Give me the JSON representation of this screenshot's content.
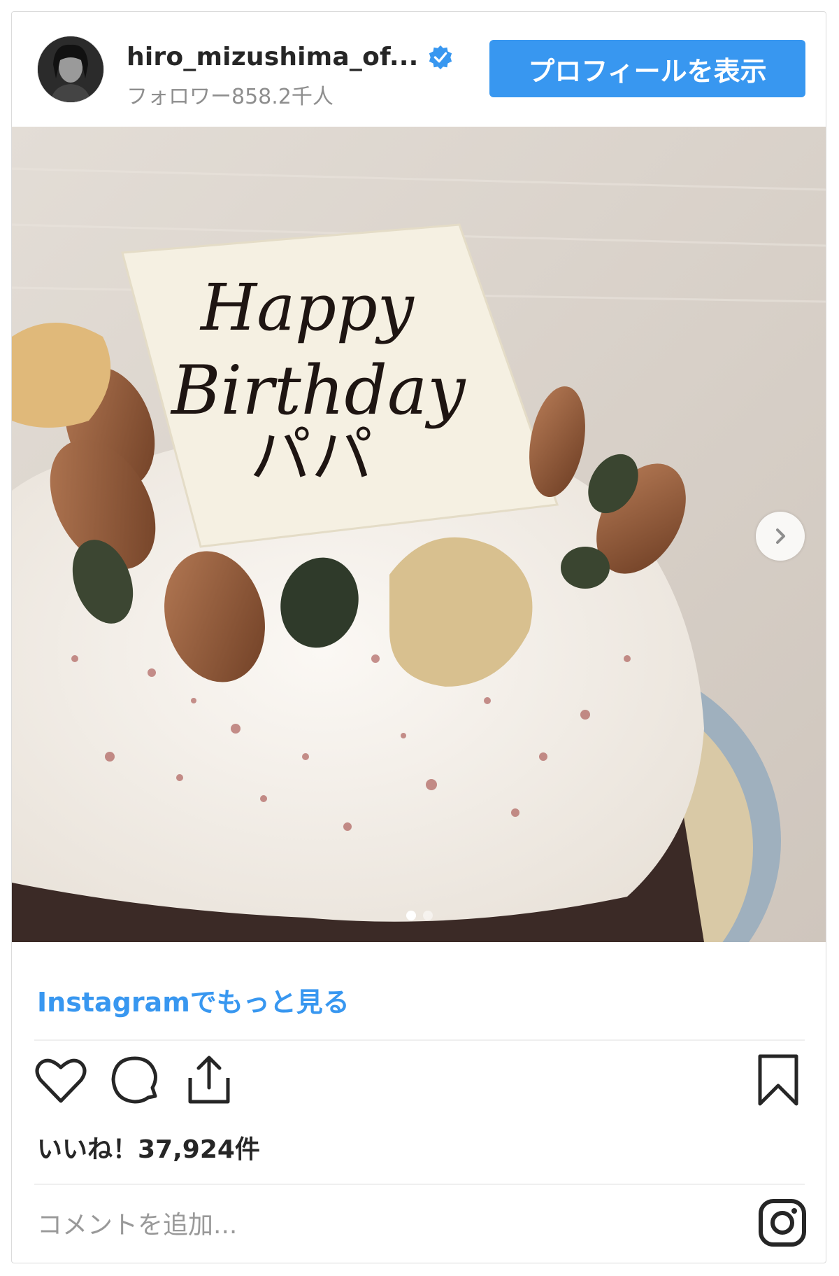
{
  "header": {
    "username": "hiro_mizushima_of...",
    "followers": "フォロワー858.2千人",
    "profile_button": "プロフィールを表示"
  },
  "photo": {
    "plaque_line1": "Happy",
    "plaque_line2": "Birthday",
    "plaque_line3": "パパ",
    "slide_count": 2,
    "active_slide": 1
  },
  "footer": {
    "more_link": "Instagramでもっと見る",
    "likes": "いいね！37,924件",
    "comment_placeholder": "コメントを追加..."
  },
  "colors": {
    "accent": "#3897f0",
    "text": "#262626",
    "muted": "#8e8e8e"
  },
  "icons": [
    "verified-badge-icon",
    "chevron-right-icon",
    "heart-icon",
    "comment-icon",
    "share-icon",
    "bookmark-icon",
    "instagram-logo-icon"
  ]
}
